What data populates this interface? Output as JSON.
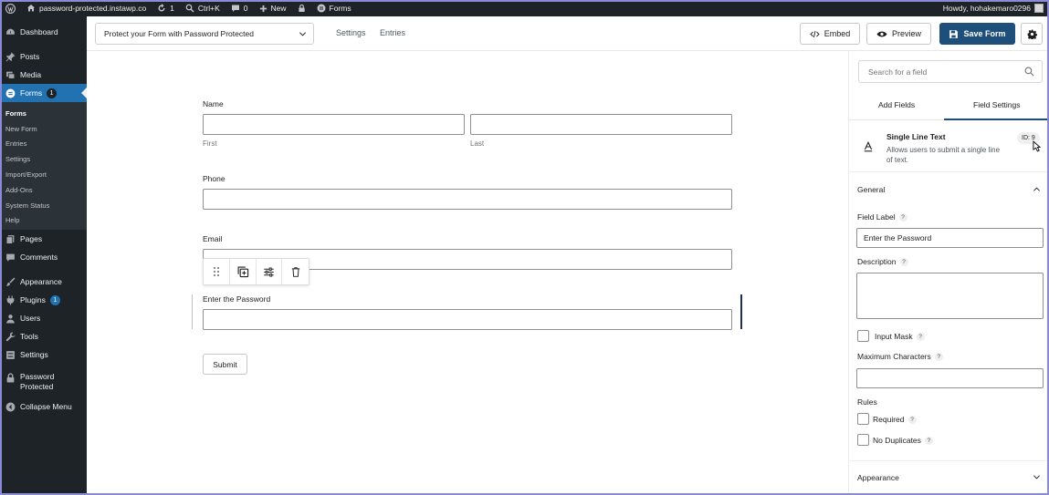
{
  "adminbar": {
    "site_name": "password-protected.instawp.co",
    "updates_count": "1",
    "search_shortcut": "Ctrl+K",
    "comments_count": "0",
    "new_label": "New",
    "forms_label": "Forms",
    "howdy": "Howdy, hohakemaro0296"
  },
  "sidebar": {
    "dashboard": "Dashboard",
    "posts": "Posts",
    "media": "Media",
    "forms": "Forms",
    "forms_badge": "1",
    "submenu": [
      "Forms",
      "New Form",
      "Entries",
      "Settings",
      "Import/Export",
      "Add-Ons",
      "System Status",
      "Help"
    ],
    "pages": "Pages",
    "comments": "Comments",
    "appearance": "Appearance",
    "plugins": "Plugins",
    "plugins_badge": "1",
    "users": "Users",
    "tools": "Tools",
    "settings": "Settings",
    "password_protected_1": "Password",
    "password_protected_2": "Protected",
    "collapse": "Collapse Menu"
  },
  "toolbar": {
    "form_title": "Protect your Form with Password Protected",
    "settings_link": "Settings",
    "entries_link": "Entries",
    "embed_label": "Embed",
    "preview_label": "Preview",
    "save_label": "Save Form"
  },
  "canvas": {
    "name_label": "Name",
    "first_sublabel": "First",
    "last_sublabel": "Last",
    "phone_label": "Phone",
    "email_label": "Email",
    "password_label": "Enter the Password",
    "submit_label": "Submit",
    "field_tools": [
      "drag-handle-icon",
      "duplicate-icon",
      "settings-sliders-icon",
      "trash-icon"
    ]
  },
  "panel": {
    "search_placeholder": "Search for a field",
    "tab_add": "Add Fields",
    "tab_settings": "Field Settings",
    "field_type": "Single Line Text",
    "field_desc": "Allows users to submit a single line of text.",
    "field_id": "ID: 9",
    "general": "General",
    "field_label_label": "Field Label",
    "field_label_value": "Enter the Password",
    "description_label": "Description",
    "input_mask_label": "Input Mask",
    "max_chars_label": "Maximum Characters",
    "rules_label": "Rules",
    "required_label": "Required",
    "no_duplicates_label": "No Duplicates",
    "appearance": "Appearance",
    "help_glyph": "?"
  },
  "colors": {
    "admin_dark": "#1d2327",
    "wp_blue": "#2271b1",
    "primary_button": "#1d4f7a",
    "frame_border": "#8a8ad6"
  }
}
